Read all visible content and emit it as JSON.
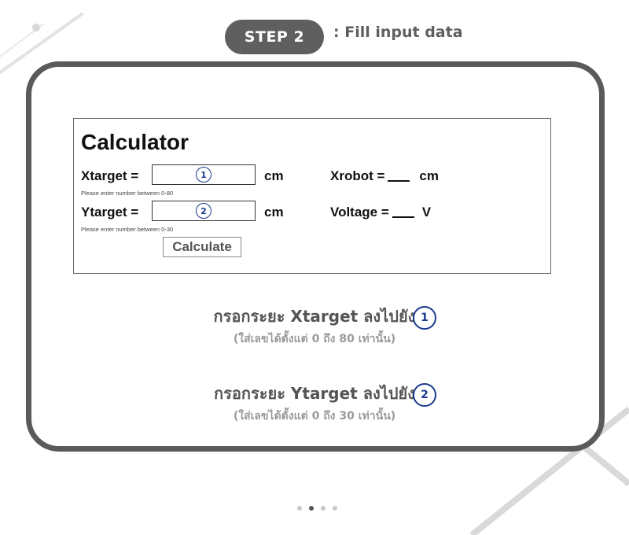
{
  "step": {
    "badge": "STEP 2",
    "description": ": Fill input data"
  },
  "calculator": {
    "title": "Calculator",
    "xtarget": {
      "label": "Xtarget =",
      "marker": "1",
      "unit": "cm",
      "hint": "Please enter number between 0-80"
    },
    "ytarget": {
      "label": "Ytarget =",
      "marker": "2",
      "unit": "cm",
      "hint": "Please enter number between 0-30"
    },
    "xrobot": {
      "label": "Xrobot =",
      "unit": "cm"
    },
    "voltage": {
      "label": "Voltage =",
      "unit": "V"
    },
    "calculate_label": "Calculate"
  },
  "instructions": [
    {
      "main": "กรอกระยะ Xtarget ลงไปยัง",
      "sub": "(ใส่เลขได้ตั้งแต่ 0 ถึง 80 เท่านั้น)",
      "marker": "1"
    },
    {
      "main": "กรอกระยะ Ytarget ลงไปยัง",
      "sub": "(ใส่เลขได้ตั้งแต่ 0 ถึง 30 เท่านั้น)",
      "marker": "2"
    }
  ],
  "pagination": {
    "total": 4,
    "active": 2
  },
  "colors": {
    "frame": "#5a5a5a",
    "pill": "#5f5f5f",
    "marker": "#1b3a8c",
    "decor": "#d9d9d9"
  }
}
